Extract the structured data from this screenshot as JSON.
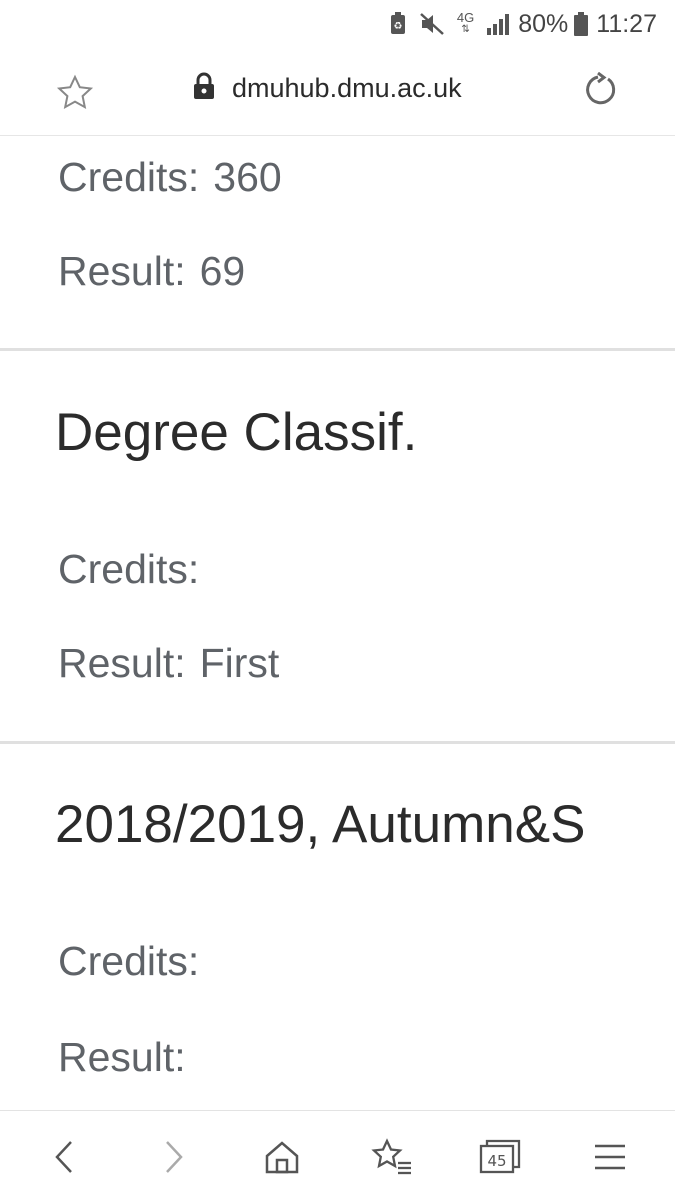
{
  "status_bar": {
    "battery_percent": "80%",
    "time": "11:27",
    "network": "4G"
  },
  "browser": {
    "url": "dmuhub.dmu.ac.uk"
  },
  "sections": [
    {
      "heading": "",
      "credits_label": "Credits:",
      "credits_value": "360",
      "result_label": "Result:",
      "result_value": "69"
    },
    {
      "heading": "Degree Classif.",
      "credits_label": "Credits:",
      "credits_value": "",
      "result_label": "Result:",
      "result_value": "First"
    },
    {
      "heading": "2018/2019, Autumn&S",
      "credits_label": "Credits:",
      "credits_value": "",
      "result_label": "Result:",
      "result_value": ""
    }
  ],
  "nav": {
    "tab_count": "45",
    "icons": [
      "back-icon",
      "forward-icon",
      "home-icon",
      "bookmarks-icon",
      "tabs-icon",
      "menu-icon"
    ]
  }
}
